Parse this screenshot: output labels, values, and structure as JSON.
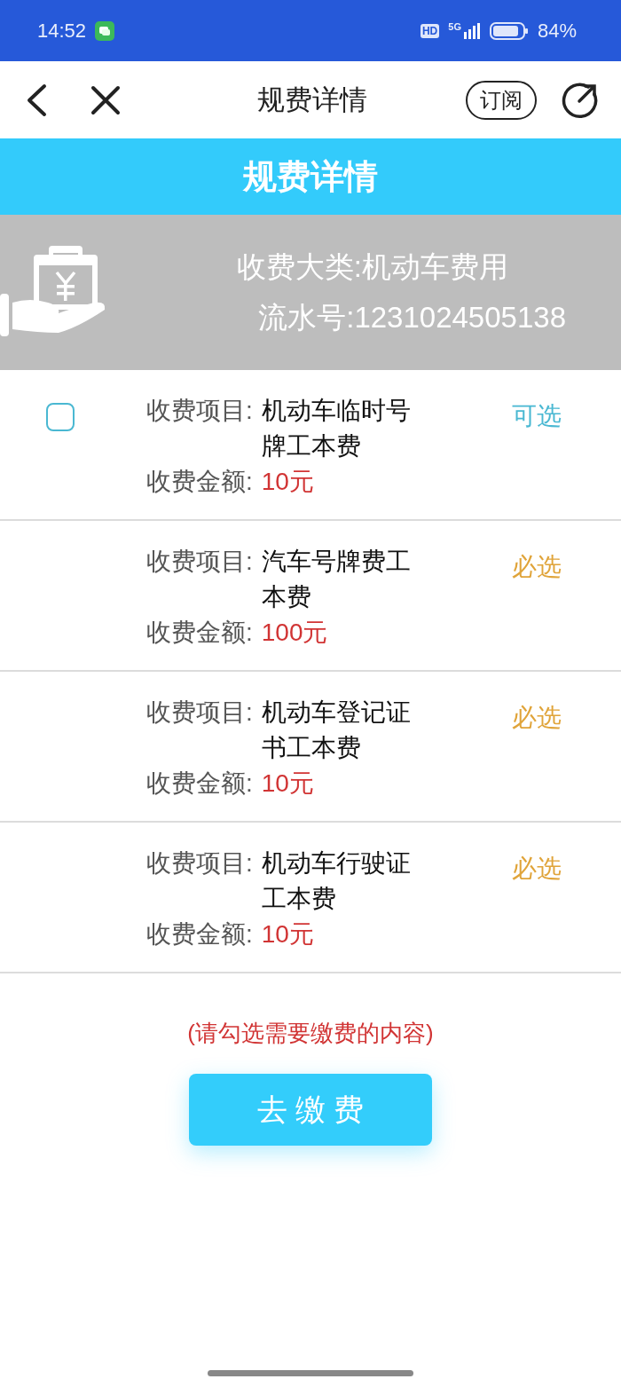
{
  "status_bar": {
    "time": "14:52",
    "battery": "84%",
    "network": "5G",
    "hd": "HD"
  },
  "nav_bar": {
    "title": "规费详情",
    "subscribe": "订阅"
  },
  "banner": {
    "title": "规费详情"
  },
  "summary": {
    "category_label": "收费大类:",
    "category": "机动车费用",
    "serial_label": "流水号:",
    "serial": "1231024505138"
  },
  "fees": [
    {
      "kind": "optional",
      "checked": false,
      "item_label": "收费项目:",
      "item": "机动车临时号牌工本费",
      "amount_label": "收费金额:",
      "amount": "10元",
      "tag": "可选"
    },
    {
      "kind": "required",
      "item_label": "收费项目:",
      "item": "汽车号牌费工本费",
      "amount_label": "收费金额:",
      "amount": "100元",
      "tag": "必选"
    },
    {
      "kind": "required",
      "item_label": "收费项目:",
      "item": "机动车登记证书工本费",
      "amount_label": "收费金额:",
      "amount": "10元",
      "tag": "必选"
    },
    {
      "kind": "required",
      "item_label": "收费项目:",
      "item": "机动车行驶证工本费",
      "amount_label": "收费金额:",
      "amount": "10元",
      "tag": "必选"
    }
  ],
  "hint": "(请勾选需要缴费的内容)",
  "pay_button": "去 缴 费"
}
